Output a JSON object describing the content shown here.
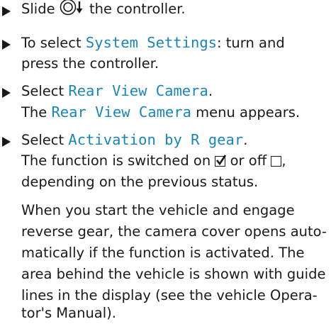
{
  "steps": [
    {
      "pre": "Slide ",
      "post": " the controller."
    },
    {
      "pre": "To select ",
      "mono": "System Settings",
      "post": ": turn and",
      "line2": "press the controller."
    },
    {
      "pre": "Select ",
      "mono": "Rear View Camera",
      "post": ".",
      "line2_pre": "The ",
      "line2_mono": "Rear View Camera",
      "line2_post": " menu appears."
    },
    {
      "pre": "Select ",
      "mono": "Activation by R gear",
      "post": ".",
      "line2_pre": "The function is switched on ",
      "line2_mid": " or off ",
      "line2_post": ",",
      "line3": "depending on the previous status."
    }
  ],
  "paragraph": [
    "When you start the vehicle and engage",
    "reverse gear, the camera cover opens auto-",
    "matically if the function is activated. The",
    "area behind the vehicle is shown with guide",
    "lines in the display (see the vehicle Opera-",
    "tor's Manual)."
  ],
  "icons": {
    "controller": "controller-slide-down-icon",
    "checked": "checkbox-checked-icon",
    "unchecked": "checkbox-unchecked-icon"
  },
  "colors": {
    "highlight": "#1a86b8",
    "text": "#1a1a1a"
  }
}
